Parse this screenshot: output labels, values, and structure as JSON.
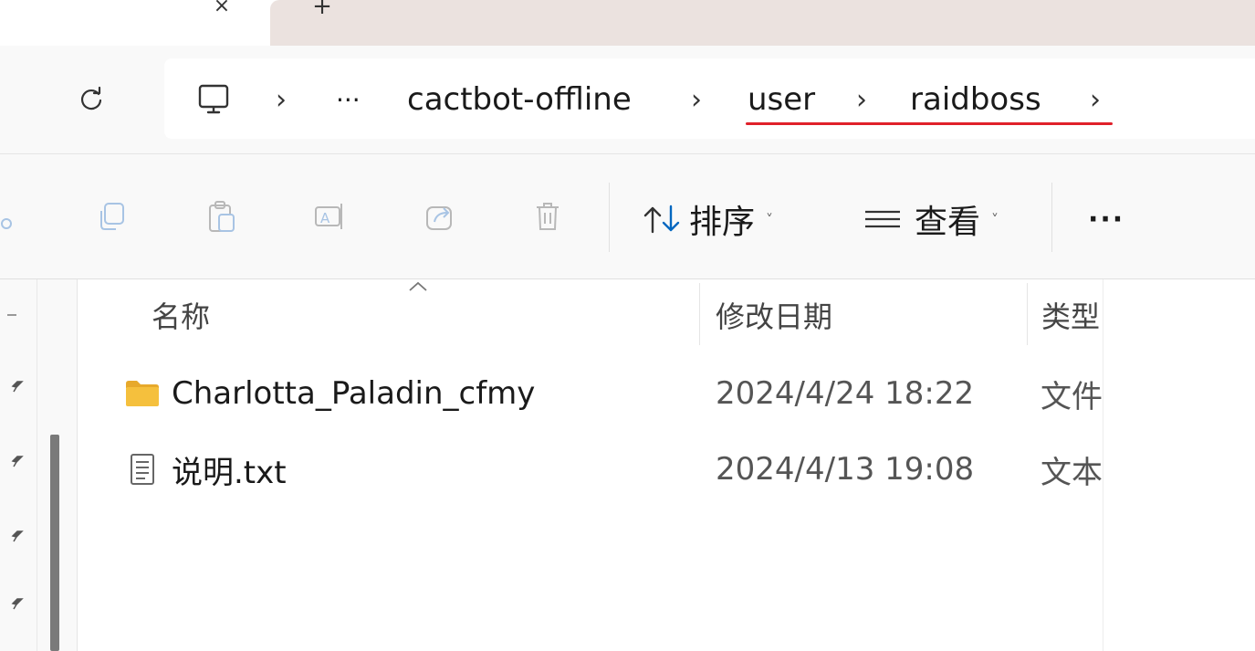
{
  "tabs": {
    "close_glyph": "×",
    "new_tab_glyph": "+"
  },
  "address": {
    "overflow": "···",
    "crumbs": [
      "cactbot-offline",
      "user",
      "raidboss"
    ],
    "separator": "›"
  },
  "commandbar": {
    "sort_label": "排序",
    "view_label": "查看",
    "more_label": "···"
  },
  "columns": {
    "name": "名称",
    "modified": "修改日期",
    "type": "类型"
  },
  "files": [
    {
      "name": "Charlotta_Paladin_cfmy",
      "modified": "2024/4/24 18:22",
      "type": "文件",
      "kind": "folder"
    },
    {
      "name": "说明.txt",
      "modified": "2024/4/13 19:08",
      "type": "文本",
      "kind": "text"
    }
  ],
  "colors": {
    "accent_blue": "#0067c0",
    "folder_yellow": "#f5c03d",
    "underline_red": "#e0202a",
    "tab_inactive_bg": "#ebe2df"
  }
}
